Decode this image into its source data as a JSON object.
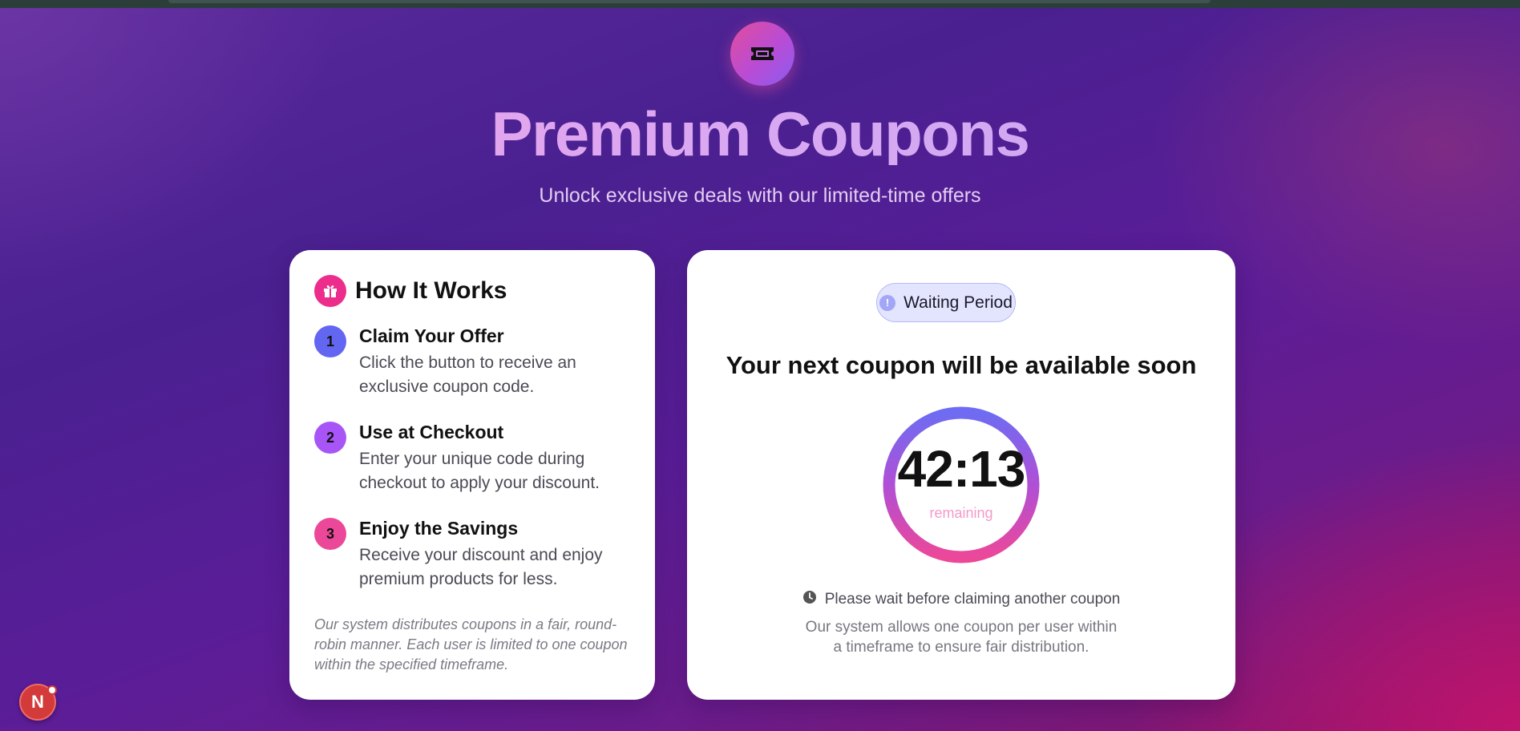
{
  "hero": {
    "icon": "ticket-icon",
    "title": "Premium Coupons",
    "subtitle": "Unlock exclusive deals with our limited-time offers"
  },
  "how_it_works": {
    "icon": "gift-icon",
    "title": "How It Works",
    "steps": [
      {
        "number": "1",
        "title": "Claim Your Offer",
        "description": "Click the button to receive an exclusive coupon code.",
        "color": "#6366f1"
      },
      {
        "number": "2",
        "title": "Use at Checkout",
        "description": "Enter your unique code during checkout to apply your discount.",
        "color": "#a855f7"
      },
      {
        "number": "3",
        "title": "Enjoy the Savings",
        "description": "Receive your discount and enjoy premium products for less.",
        "color": "#ec4899"
      }
    ],
    "footnote": "Our system distributes coupons in a fair, round-robin manner. Each user is limited to one coupon within the specified timeframe."
  },
  "waiting": {
    "status_icon": "alert-circle-icon",
    "status_label": "Waiting Period",
    "heading": "Your next coupon will be available soon",
    "timer": {
      "value": "42:13",
      "label": "remaining"
    },
    "note_icon": "clock-icon",
    "note": "Please wait before claiming another coupon",
    "explanation": "Our system allows one coupon per user within a timeframe to ensure fair distribution."
  },
  "dev_indicator": {
    "letter": "N",
    "icon": "nextjs-icon"
  },
  "colors": {
    "accent_pink": "#ec2d8b",
    "accent_indigo": "#6366f1",
    "accent_purple": "#a855f7",
    "background_start": "#5a2a9c",
    "background_end": "#c21a6e"
  }
}
